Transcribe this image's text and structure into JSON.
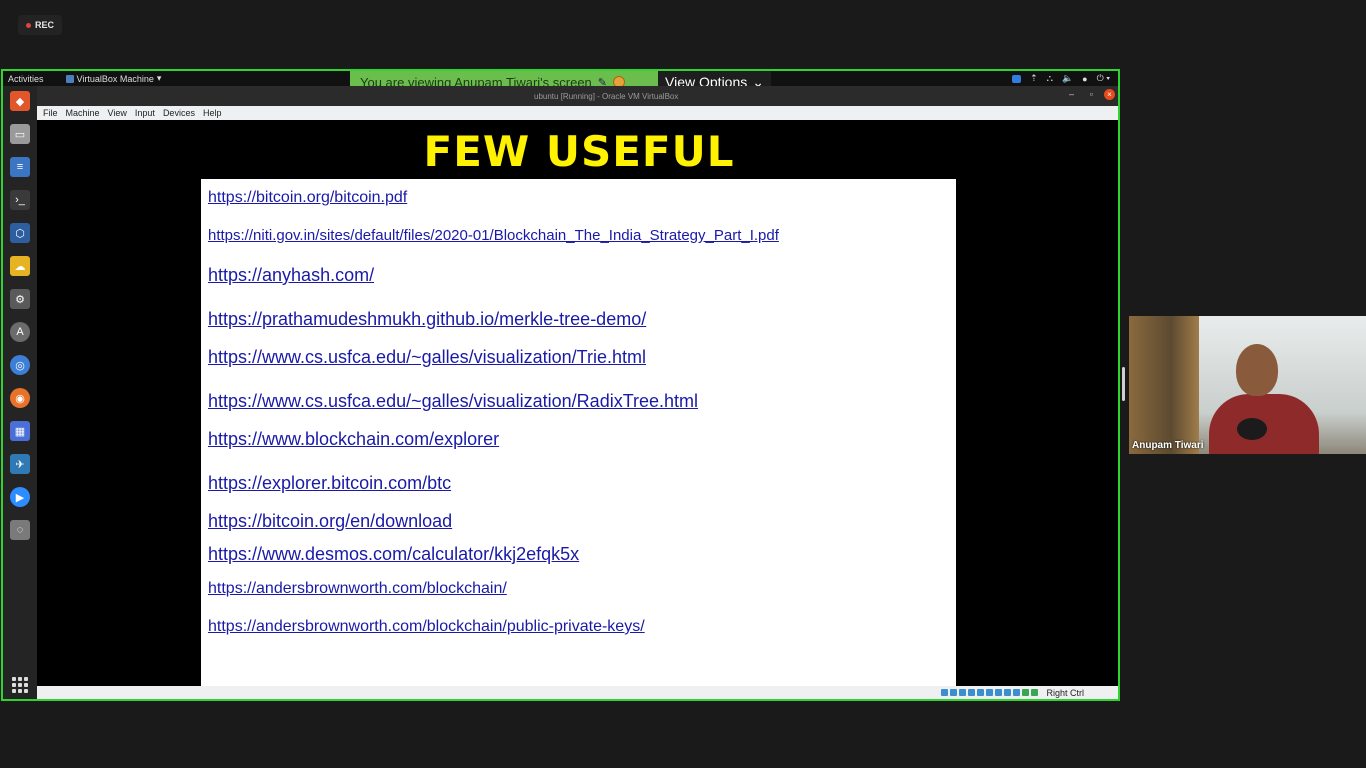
{
  "recording": {
    "label": "REC"
  },
  "share_banner": {
    "text": "You are viewing Anupam Tiwari's screen",
    "view_options": "View Options"
  },
  "gnome_topbar": {
    "activities": "Activities",
    "app_name": "VirtualBox Machine"
  },
  "vm_window": {
    "title": "ubuntu [Running] - Oracle VM VirtualBox"
  },
  "vbox_menu": [
    "File",
    "Machine",
    "View",
    "Input",
    "Devices",
    "Help"
  ],
  "slide": {
    "title": "FEW USEFUL LINKS",
    "links": [
      "https://bitcoin.org/bitcoin.pdf",
      "https://niti.gov.in/sites/default/files/2020-01/Blockchain_The_India_Strategy_Part_I.pdf",
      "https://anyhash.com/",
      "https://prathamudeshmukh.github.io/merkle-tree-demo/",
      "https://www.cs.usfca.edu/~galles/visualization/Trie.html",
      "https://www.cs.usfca.edu/~galles/visualization/RadixTree.html",
      "https://www.blockchain.com/explorer",
      "https://explorer.bitcoin.com/btc",
      "https://bitcoin.org/en/download",
      "https://www.desmos.com/calculator/kkj2efqk5x",
      "https://andersbrownworth.com/blockchain/",
      "https://andersbrownworth.com/blockchain/public-private-keys/"
    ]
  },
  "vbox_status": {
    "host_key": "Right Ctrl"
  },
  "participant": {
    "name": "Anupam Tiwari"
  },
  "dock_icons": [
    "brave-browser-icon",
    "files-icon",
    "text-editor-icon",
    "terminal-icon",
    "virtualbox-icon",
    "weather-icon",
    "settings-icon",
    "software-store-icon",
    "chromium-icon",
    "firefox-icon",
    "screenshot-icon",
    "draw-icon",
    "zoom-icon",
    "disk-icon"
  ],
  "colors": {
    "frame": "#2fd42f",
    "banner": "#6bbd4e",
    "slide_title": "#fff200",
    "link": "#1a1aa8"
  }
}
